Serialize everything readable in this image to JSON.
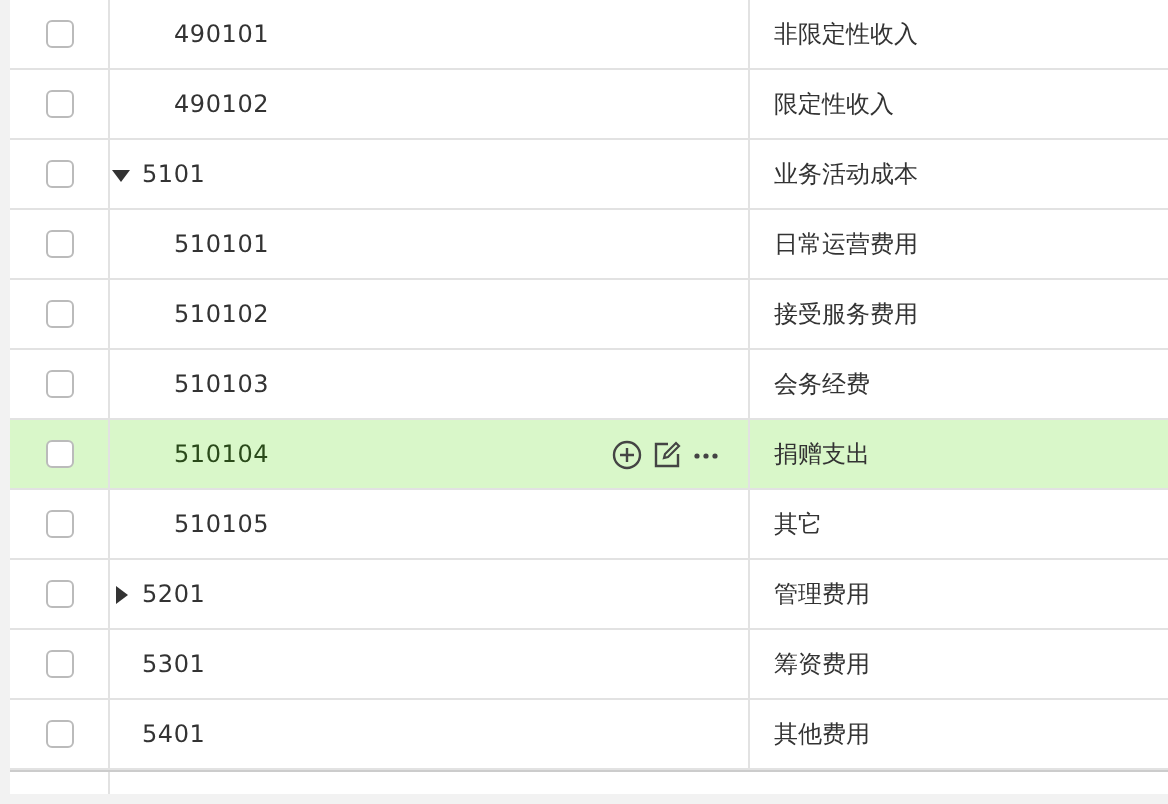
{
  "tree": {
    "partial_group": {
      "children": [
        {
          "code": "490101",
          "name": "非限定性收入",
          "checked": false,
          "selected": false
        },
        {
          "code": "490102",
          "name": "限定性收入",
          "checked": false,
          "selected": false
        }
      ]
    },
    "rows": [
      {
        "code": "5101",
        "name": "业务活动成本",
        "checked": false,
        "selected": false,
        "expanded": true,
        "children": [
          {
            "code": "510101",
            "name": "日常运营费用",
            "checked": false,
            "selected": false
          },
          {
            "code": "510102",
            "name": "接受服务费用",
            "checked": false,
            "selected": false
          },
          {
            "code": "510103",
            "name": "会务经费",
            "checked": false,
            "selected": false
          },
          {
            "code": "510104",
            "name": "捐赠支出",
            "checked": false,
            "selected": true
          },
          {
            "code": "510105",
            "name": "其它",
            "checked": false,
            "selected": false
          }
        ]
      },
      {
        "code": "5201",
        "name": "管理费用",
        "checked": false,
        "selected": false,
        "expanded": false
      },
      {
        "code": "5301",
        "name": "筹资费用",
        "checked": false,
        "selected": false
      },
      {
        "code": "5401",
        "name": "其他费用",
        "checked": false,
        "selected": false
      }
    ]
  }
}
